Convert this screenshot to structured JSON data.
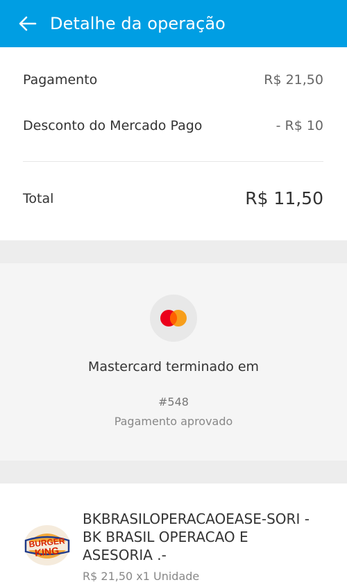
{
  "header": {
    "title": "Detalhe da operação"
  },
  "summary": {
    "payment_label": "Pagamento",
    "payment_value": "R$ 21,50",
    "discount_label": "Desconto do Mercado Pago",
    "discount_value": "- R$ 10",
    "total_label": "Total",
    "total_value": "R$ 11,50"
  },
  "payment": {
    "card_text": "Mastercard terminado em",
    "operation_code": "#548",
    "status": "Pagamento aprovado",
    "brand_colors": {
      "red": "#eb001b",
      "orange": "#f79e1b"
    }
  },
  "merchant": {
    "name": "BKBRASILOPERACAOEASE-SORI - BK BRASIL OPERACAO E ASESORIA  .-",
    "price_line": "R$ 21,50 x1 Unidade",
    "logo_text_top": "BURGER",
    "logo_text_bottom": "KING"
  },
  "colors": {
    "header_bg": "#009ee3",
    "page_bg": "#ededed"
  }
}
